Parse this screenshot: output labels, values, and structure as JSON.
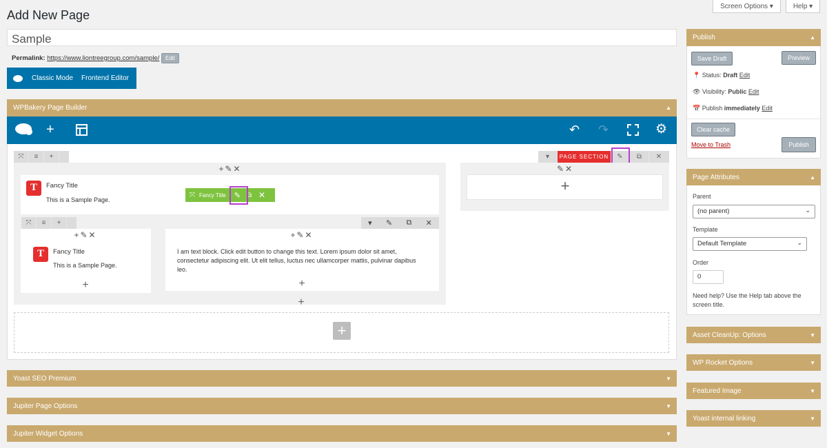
{
  "page": {
    "title": "Add New Page"
  },
  "top_tabs": {
    "screen_options": "Screen Options ▾",
    "help": "Help ▾"
  },
  "title_input": {
    "value": "Sample"
  },
  "permalink": {
    "label": "Permalink:",
    "url": "https://www.liontreegroup.com/sample/",
    "edit": "Edit"
  },
  "mode_bar": {
    "classic": "Classic Mode",
    "frontend": "Frontend Editor"
  },
  "wpbakery": {
    "header": "WPBakery Page Builder",
    "page_section_label": "PAGE SECTION",
    "fancy_title_1": {
      "title": "Fancy Title",
      "subtitle": "This is a Sample Page."
    },
    "green_label": "Fancy Title",
    "fancy_title_2": {
      "title": "Fancy Title",
      "subtitle": "This is a Sample Page."
    },
    "text_block": "I am text block. Click edit button to change this text. Lorem ipsum dolor sit amet, consectetur adipiscing elit. Ut elit tellus, luctus nec ullamcorper mattis, pulvinar dapibus leo."
  },
  "bottom_boxes": [
    "Yoast SEO Premium",
    "Jupiter Page Options",
    "Jupiter Widget Options"
  ],
  "publish": {
    "header": "Publish",
    "save_draft": "Save Draft",
    "preview": "Preview",
    "status_label": "Status:",
    "status_value": "Draft",
    "status_edit": "Edit",
    "visibility_label": "Visibility:",
    "visibility_value": "Public",
    "visibility_edit": "Edit",
    "publish_label": "Publish",
    "publish_value": "immediately",
    "publish_edit": "Edit",
    "clear_cache": "Clear cache",
    "trash": "Move to Trash",
    "publish_btn": "Publish"
  },
  "attributes": {
    "header": "Page Attributes",
    "parent_label": "Parent",
    "parent_value": "(no parent)",
    "template_label": "Template",
    "template_value": "Default Template",
    "order_label": "Order",
    "order_value": "0",
    "help": "Need help? Use the Help tab above the screen title."
  },
  "side_boxes": [
    "Asset CleanUp: Options",
    "WP Rocket Options",
    "Featured Image",
    "Yoast internal linking"
  ],
  "colors": {
    "gold": "#c9a96e",
    "blue": "#0073aa",
    "red": "#e52e2e",
    "green": "#7ec33f",
    "highlight": "#b63fcb"
  }
}
